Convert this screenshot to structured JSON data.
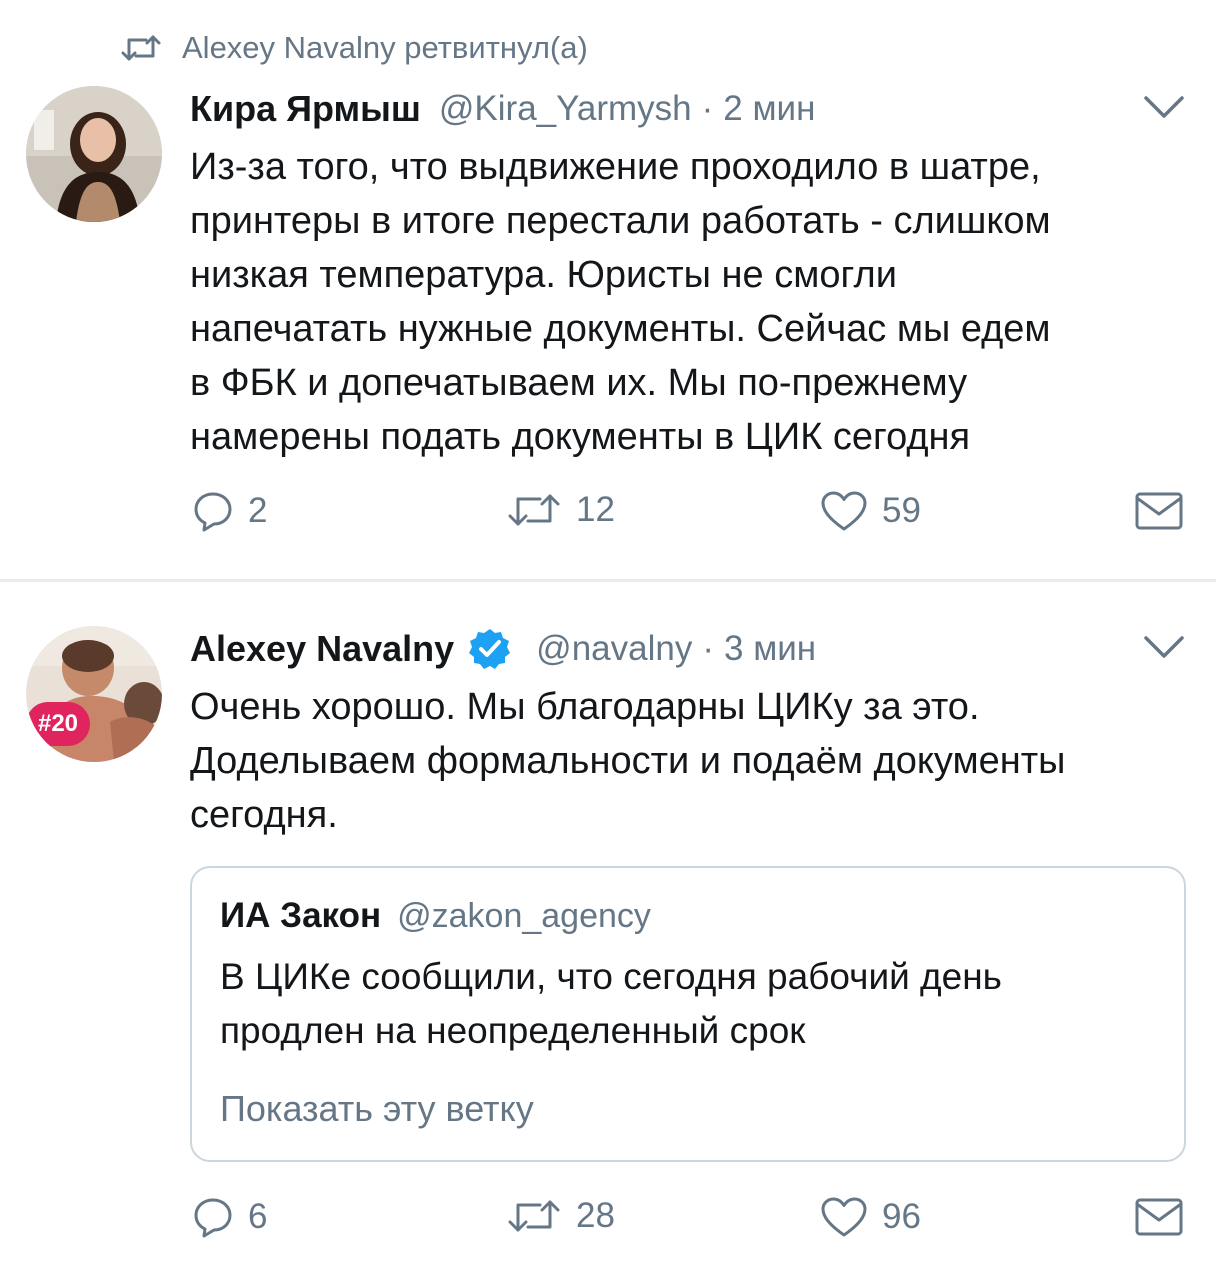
{
  "retweet_context": {
    "icon": "retweet-icon",
    "text": "Alexey Navalny ретвитнул(а)"
  },
  "tweets": [
    {
      "author_name": "Кира Ярмыш",
      "handle": "@Kira_Yarmysh",
      "separator": "·",
      "time": "2 мин",
      "text": "Из-за того, что выдвижение проходило в шатре,\nпринтеры в итоге перестали работать - слишком\nнизкая температура. Юристы не смогли\nнапечатать нужные документы. Сейчас мы едем\nв ФБК и допечатываем их. Мы по-прежнему\nнамерены подать документы в ЦИК сегодня",
      "replies": "2",
      "retweets": "12",
      "likes": "59"
    },
    {
      "author_name": "Alexey Navalny",
      "handle": "@navalny",
      "separator": "·",
      "time": "3 мин",
      "avatar_badge": "#20",
      "text": "Очень хорошо. Мы благодарны ЦИКу за это.\nДоделываем формальности и подаём документы\nсегодня.",
      "quoted": {
        "author_name": "ИА Закон",
        "handle": "@zakon_agency",
        "text": "В ЦИКе сообщили, что сегодня  рабочий день\nпродлен на неопределенный срок",
        "show_thread": "Показать эту ветку"
      },
      "replies": "6",
      "retweets": "28",
      "likes": "96"
    }
  ],
  "colors": {
    "muted": "#657786",
    "text": "#14171a",
    "verified": "#1da1f2",
    "border": "#ccd6dd"
  }
}
